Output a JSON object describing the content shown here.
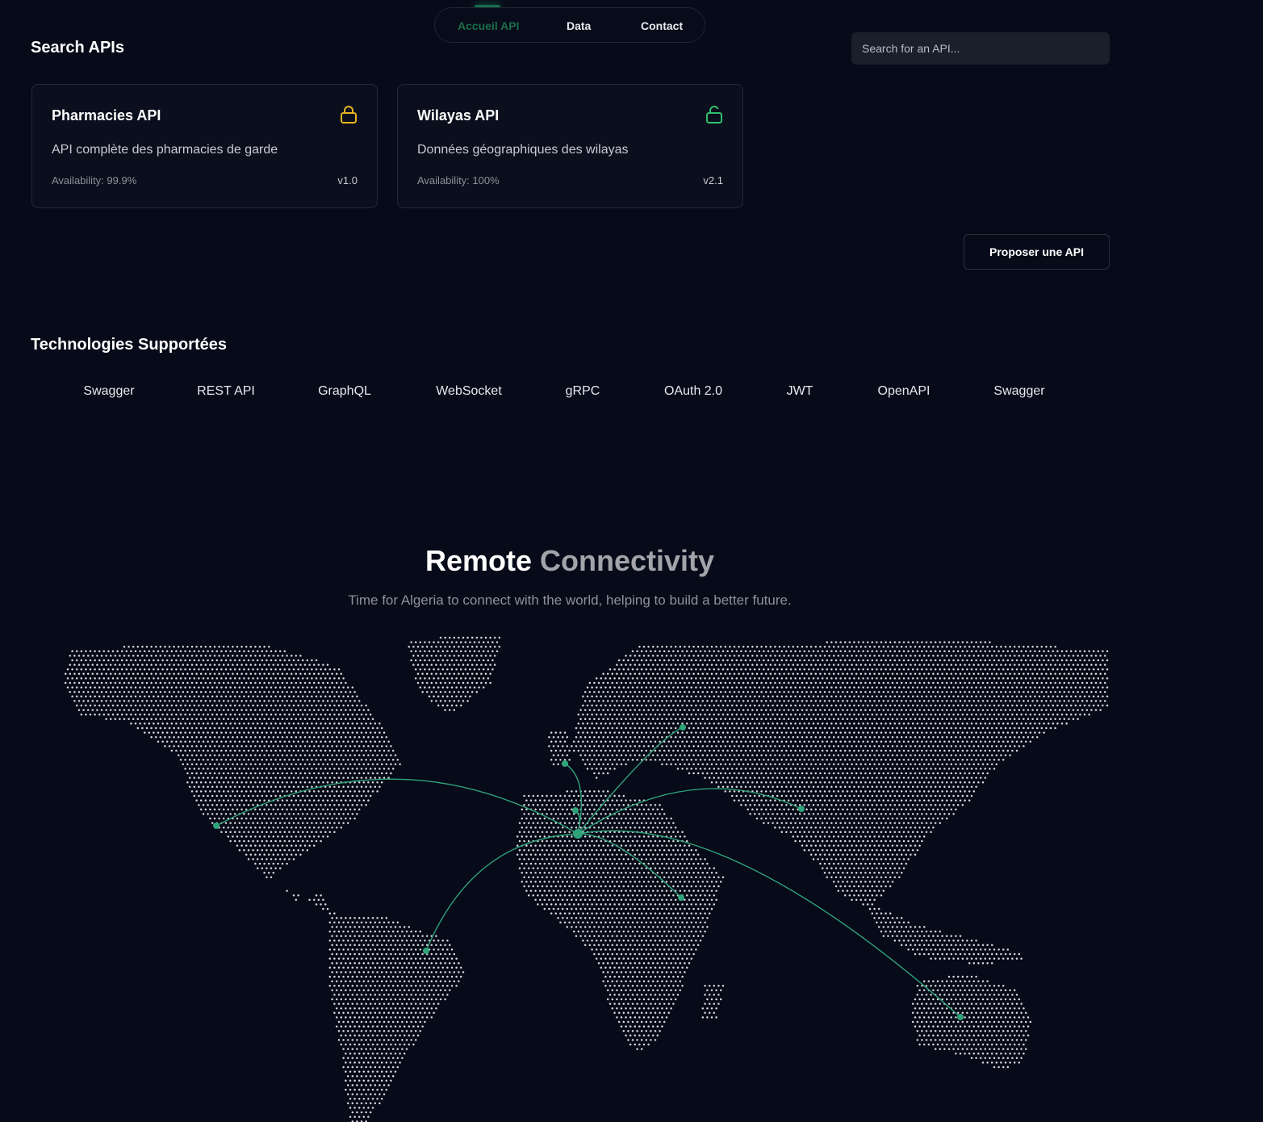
{
  "nav": {
    "items": [
      {
        "label": "Accueil API",
        "active": true
      },
      {
        "label": "Data",
        "active": false
      },
      {
        "label": "Contact",
        "active": false
      }
    ]
  },
  "search": {
    "title": "Search APIs",
    "placeholder": "Search for an API..."
  },
  "apis": [
    {
      "title": "Pharmacies API",
      "description": "API complète des pharmacies de garde",
      "availability": "Availability: 99.9%",
      "version": "v1.0",
      "icon": "lock-icon",
      "icon_color": "#e8b423"
    },
    {
      "title": "Wilayas API",
      "description": "Données géographiques des wilayas",
      "availability": "Availability: 100%",
      "version": "v2.1",
      "icon": "unlock-icon",
      "icon_color": "#2fbf6f"
    }
  ],
  "propose_button": "Proposer une API",
  "technologies": {
    "title": "Technologies Supportées",
    "items": [
      "Swagger",
      "REST API",
      "GraphQL",
      "WebSocket",
      "gRPC",
      "OAuth 2.0",
      "JWT",
      "OpenAPI",
      "Swagger"
    ]
  },
  "hero": {
    "title_primary": "Remote",
    "title_secondary": "Connectivity",
    "subtitle": "Time for Algeria to connect with the world, helping to build a better future."
  },
  "colors": {
    "background": "#070a18",
    "accent": "#2fa37a",
    "map_dots": "#d9d9d9"
  }
}
